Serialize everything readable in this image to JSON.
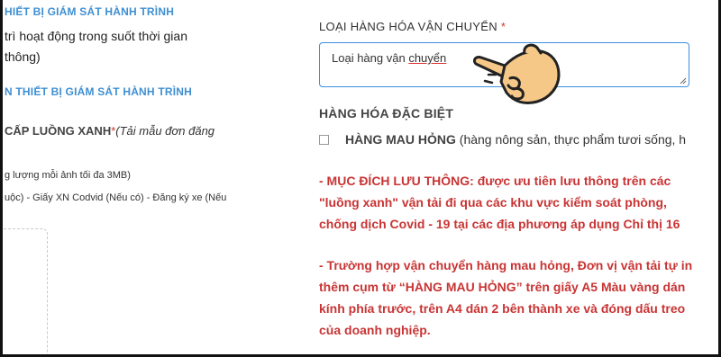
{
  "left": {
    "line1": "HIẾT BỊ GIÁM SÁT HÀNH TRÌNH",
    "line2": "trì hoạt động trong suốt thời gian",
    "line3": "thông)",
    "line4": "N THIẾT BỊ GIÁM SÁT HÀNH TRÌNH",
    "line5_bold": "CẤP LUỒNG XANH",
    "line5_star": "*",
    "line5_italic": "(Tải mẫu đơn đăng",
    "line6": "g lượng mỗi ảnh tối đa 3MB)",
    "line7": "uộc) - Giấy XN Codvid (Nếu có) - Đăng ký xe (Nếu"
  },
  "form": {
    "cargo_label": "LOẠI HÀNG HÓA VẬN CHUYỂN",
    "required_star": "*",
    "cargo_value_plain": "Loại hàng vận",
    "cargo_value_underlined": "chuyển",
    "special_title": "HÀNG HÓA ĐẶC BIỆT",
    "perishable_bold": "HÀNG MAU HỎNG",
    "perishable_rest": "(hàng nông sản, thực phẩm tươi sống, h"
  },
  "notes": {
    "purpose": "- MỤC ĐÍCH LƯU THÔNG: được ưu tiên lưu thông trên các \"luồng xanh\" vận tải đi qua các khu vực kiểm soát phòng, chống dịch Covid - 19 tại các địa phương áp dụng Chỉ thị 16",
    "instruction": "- Trường hợp vận chuyển hàng mau hỏng, Đơn vị vận tải tự in thêm cụm từ “HÀNG MAU HỎNG” trên giấy A5 Màu vàng dán kính phía trước, trên A4 dán 2 bên thành xe và đóng dấu treo của doanh nghiệp."
  },
  "colors": {
    "heading_blue": "#3f8fd2",
    "note_red": "#c93434",
    "focus_border": "#3d8fe0",
    "hand_skin": "#f6c888"
  },
  "icons": {
    "pointer": "pointing-hand-icon"
  }
}
